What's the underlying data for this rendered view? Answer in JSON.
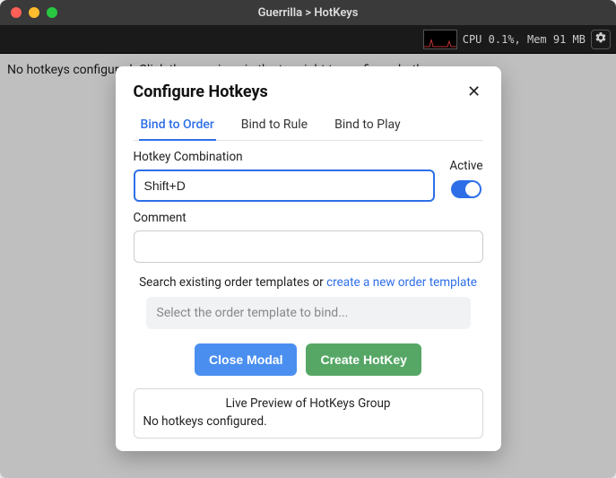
{
  "window": {
    "title": "Guerrilla > HotKeys"
  },
  "toolbar": {
    "stats": "CPU 0.1%, Mem 91 MB"
  },
  "background": {
    "message": "No hotkeys configured. Click the gear icon in the top right to configure hotkeys."
  },
  "modal": {
    "title": "Configure Hotkeys",
    "tabs": [
      {
        "label": "Bind to Order",
        "active": true
      },
      {
        "label": "Bind to Rule",
        "active": false
      },
      {
        "label": "Bind to Play",
        "active": false
      }
    ],
    "hotkey_label": "Hotkey Combination",
    "hotkey_value": "Shift+D",
    "active_label": "Active",
    "comment_label": "Comment",
    "comment_value": "",
    "search_hint_prefix": "Search existing order templates or ",
    "search_hint_link": "create a new order template",
    "select_placeholder": "Select the order template to bind...",
    "btn_close": "Close Modal",
    "btn_create": "Create HotKey",
    "preview_title": "Live Preview of HotKeys Group",
    "preview_body": "No hotkeys configured."
  }
}
